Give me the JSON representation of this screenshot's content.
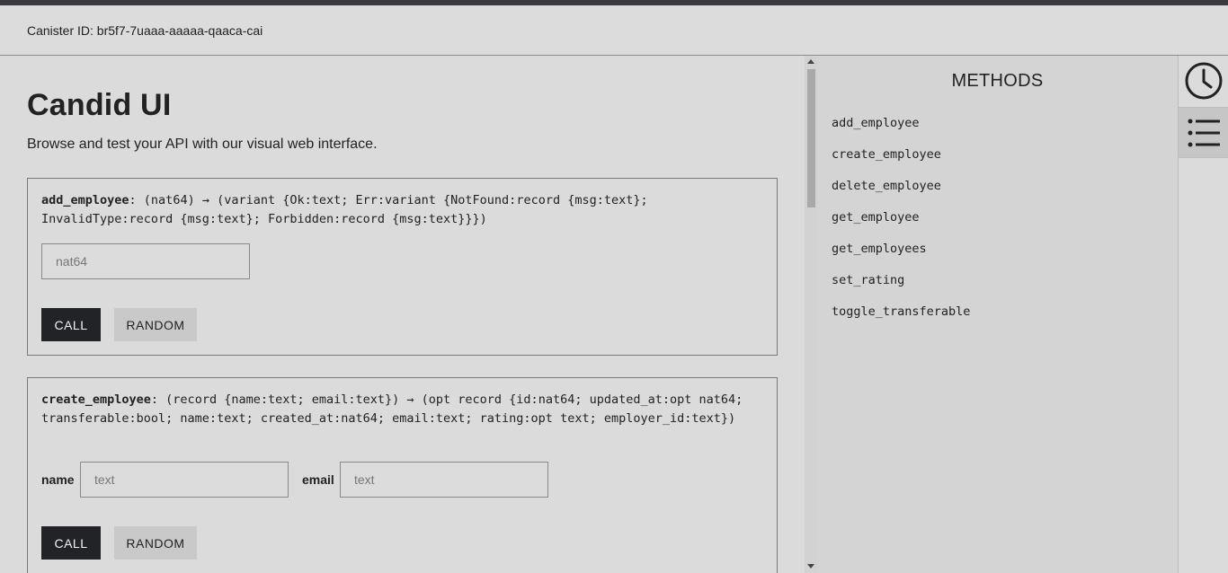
{
  "header": {
    "canister_label": "Canister ID: br5f7-7uaaa-aaaaa-qaaca-cai"
  },
  "main": {
    "title": "Candid UI",
    "subtitle": "Browse and test your API with our visual web interface."
  },
  "cards": [
    {
      "method": "add_employee",
      "signature": ": (nat64) → (variant {Ok:text; Err:variant {NotFound:record {msg:text}; InvalidType:record {msg:text}; Forbidden:record {msg:text}}})",
      "inputs": [
        {
          "label": "",
          "placeholder": "nat64",
          "value": ""
        }
      ],
      "call_label": "CALL",
      "random_label": "RANDOM"
    },
    {
      "method": "create_employee",
      "signature": ": (record {name:text; email:text}) → (opt record {id:nat64; updated_at:opt nat64; transferable:bool; name:text; created_at:nat64; email:text; rating:opt text; employer_id:text})",
      "inputs": [
        {
          "label": "name",
          "placeholder": "text",
          "value": ""
        },
        {
          "label": "email",
          "placeholder": "text",
          "value": ""
        }
      ],
      "call_label": "CALL",
      "random_label": "RANDOM"
    }
  ],
  "sidebar": {
    "title": "METHODS",
    "items": [
      "add_employee",
      "create_employee",
      "delete_employee",
      "get_employee",
      "get_employees",
      "set_rating",
      "toggle_transferable"
    ]
  },
  "rail": {
    "icons": [
      "clock-icon",
      "list-icon"
    ],
    "active": "list-icon"
  },
  "colors": {
    "background": "#dbdbdb",
    "topbar": "#3a3b3f",
    "call_button": "#222326",
    "random_button": "#c9c9c9",
    "methods_panel": "#d4d4d4"
  }
}
